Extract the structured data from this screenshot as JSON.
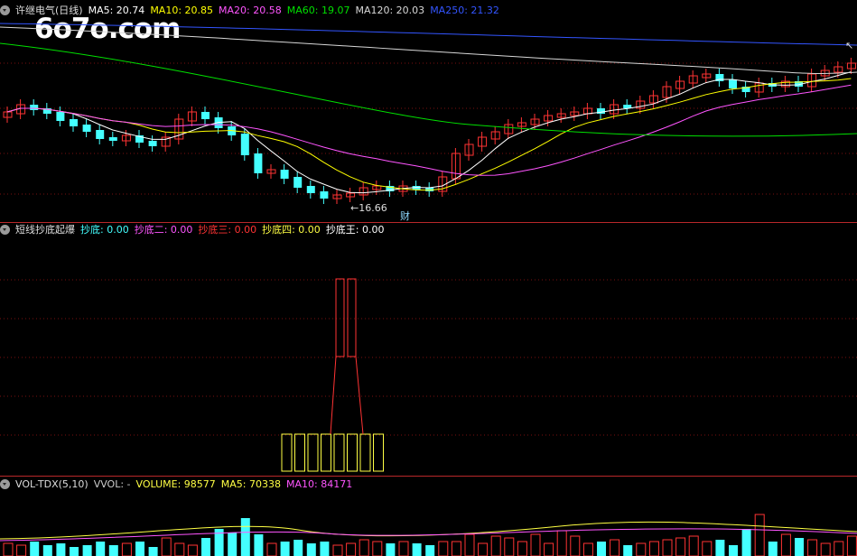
{
  "watermark": "6o7o.com",
  "main": {
    "title": "许继电气(日线)",
    "ma": [
      {
        "label": "MA5: 20.74",
        "color": "#ffffff"
      },
      {
        "label": "MA10: 20.85",
        "color": "#ffff00"
      },
      {
        "label": "MA20: 20.58",
        "color": "#ff55ff"
      },
      {
        "label": "MA60: 19.07",
        "color": "#00e000"
      },
      {
        "label": "MA120: 20.03",
        "color": "#d8d8d8"
      },
      {
        "label": "MA250: 21.32",
        "color": "#3355ff"
      }
    ],
    "low_label": "←16.66",
    "event_badge": "财",
    "arrow_mark": "↖"
  },
  "indicator": {
    "title": "短线抄底起爆",
    "items": [
      {
        "label": "抄底: 0.00",
        "color": "#44ffff"
      },
      {
        "label": "抄底二: 0.00",
        "color": "#ff55ff"
      },
      {
        "label": "抄底三: 0.00",
        "color": "#ff3333"
      },
      {
        "label": "抄底四: 0.00",
        "color": "#ffff44"
      },
      {
        "label": "抄底王: 0.00",
        "color": "#ffffff"
      }
    ]
  },
  "volume": {
    "title": "VOL-TDX(5,10)",
    "items": [
      {
        "label": "VVOL: -",
        "color": "#cccccc"
      },
      {
        "label": "VOLUME: 98577",
        "color": "#ffff44"
      },
      {
        "label": "MA5: 70338",
        "color": "#ffff44"
      },
      {
        "label": "MA10: 84171",
        "color": "#ff55ff"
      }
    ]
  },
  "colors": {
    "up": "#ff3333",
    "down": "#44ffff",
    "separator": "#b8282a",
    "grid": "#7a1010"
  }
}
